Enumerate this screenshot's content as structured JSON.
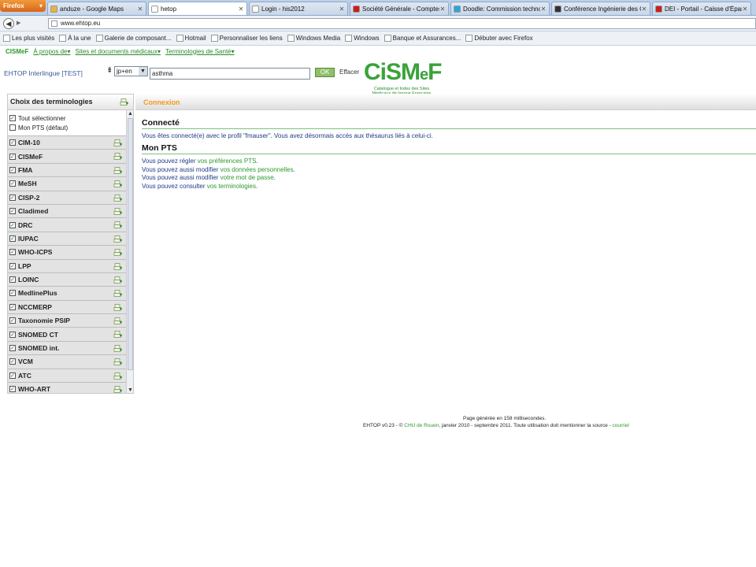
{
  "browser": {
    "menu_label": "Firefox",
    "tabs": [
      {
        "label": "anduze - Google Maps",
        "icon": "google-maps-icon",
        "color": "#e8b53a",
        "active": false
      },
      {
        "label": "hetop",
        "icon": "page-icon",
        "color": "#ffffff",
        "active": true
      },
      {
        "label": "Login - his2012",
        "icon": "page-icon",
        "color": "#ffffff",
        "active": false
      },
      {
        "label": "Société Générale - Comptes ...",
        "icon": "societe-generale-icon",
        "color": "#d11a1a",
        "active": false
      },
      {
        "label": "Doodle: Commission techno",
        "icon": "doodle-icon",
        "color": "#2aa4e0",
        "active": false
      },
      {
        "label": "Conférence Ingénierie des C...",
        "icon": "conference-icon",
        "color": "#333333",
        "active": false
      },
      {
        "label": "DEI - Portail - Caisse d'Éparg...",
        "icon": "caisse-epargne-icon",
        "color": "#cc1f1f",
        "active": false
      }
    ],
    "url": "www.ehtop.eu",
    "bookmarks": [
      {
        "label": "Les plus visités"
      },
      {
        "label": "À la une"
      },
      {
        "label": "Galerie de composant..."
      },
      {
        "label": "Hotmail"
      },
      {
        "label": "Personnaliser les liens"
      },
      {
        "label": "Windows Media"
      },
      {
        "label": "Windows"
      },
      {
        "label": "Banque et Assurances..."
      },
      {
        "label": "Débuter avec Firefox"
      }
    ]
  },
  "site": {
    "brand": "CISMeF",
    "nav": [
      "À propos de▾",
      "Sites et documents médicaux▾",
      "Terminologies de Santé▾"
    ],
    "title": "EHTOP Interlingue [TEST]",
    "lang": "jp+en",
    "query": "asthma",
    "ok_label": "OK",
    "clear_label": "Effacer",
    "logo_text": "CiSMeF",
    "logo_subtitle_1": "Catalogue et Index des Sites",
    "logo_subtitle_2": "Médicaux de langue Française"
  },
  "sidebar": {
    "title": "Choix des terminologies",
    "select_all": "Tout sélectionner",
    "my_pts": "Mon PTS (défaut)",
    "terminologies": [
      "CIM-10",
      "CISMeF",
      "FMA",
      "MeSH",
      "CISP-2",
      "Cladimed",
      "DRC",
      "IUPAC",
      "WHO-ICPS",
      "LPP",
      "LOINC",
      "MedlinePlus",
      "NCCMERP",
      "Taxonomie PSIP",
      "SNOMED CT",
      "SNOMED int.",
      "VCM",
      "ATC",
      "WHO-ART"
    ]
  },
  "main": {
    "bar_title": "Connexion",
    "connected_heading": "Connecté",
    "connected_text": "Vous êtes connecté(e) avec le profil \"fmauser\". Vous avez désormais accès aux thésaurus liés à celui-ci.",
    "pts_heading": "Mon PTS",
    "lines": [
      {
        "prefix": "Vous pouvez régler",
        "link": "vos préférences PTS",
        "suffix": "."
      },
      {
        "prefix": "Vous pouvez aussi modifier",
        "link": "vos données personnelles",
        "suffix": "."
      },
      {
        "prefix": "Vous pouvez aussi modifier",
        "link": "votre mot de passe",
        "suffix": "."
      },
      {
        "prefix": "Vous pouvez consulter",
        "link": "vos terminologies",
        "suffix": "."
      }
    ]
  },
  "footer": {
    "generated": "Page générée en 158 millisecondes.",
    "copyright_prefix": "EHTOP v0.23 - ©",
    "chu_link": "CHU de Rouen",
    "copyright_middle": ", janvier 2010 - septembre 2011. Toute utilisation doit mentionner la source -",
    "mail_link": "courriel"
  },
  "colors": {
    "brand_green": "#2a9a2a",
    "connexion_orange": "#f19b1e",
    "text_blue": "#1e3a8a"
  }
}
